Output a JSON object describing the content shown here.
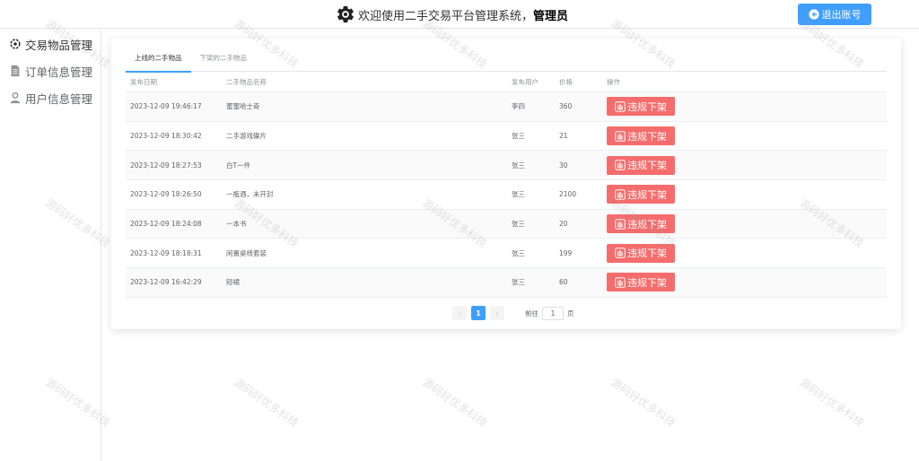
{
  "header": {
    "welcome": "欢迎使用二手交易平台管理系统，",
    "role": "管理员",
    "logout_label": "退出账号"
  },
  "sidebar": {
    "items": [
      {
        "label": "交易物品管理",
        "icon": "goods-gear-icon",
        "active": true
      },
      {
        "label": "订单信息管理",
        "icon": "document-icon",
        "active": false
      },
      {
        "label": "用户信息管理",
        "icon": "user-icon",
        "active": false
      }
    ]
  },
  "tabs": [
    {
      "label": "上线的二手物品",
      "active": true
    },
    {
      "label": "下架的二手物品",
      "active": false
    }
  ],
  "table": {
    "columns": [
      "发布日期",
      "二手物品名称",
      "发布用户",
      "价格",
      "操作"
    ],
    "action_label": "违规下架",
    "rows": [
      {
        "date": "2023-12-09 19:46:17",
        "name": "蜜蜜哈士奇",
        "user": "李四",
        "price": "360"
      },
      {
        "date": "2023-12-09 18:30:42",
        "name": "二手游戏碟片",
        "user": "张三",
        "price": "21"
      },
      {
        "date": "2023-12-09 18:27:53",
        "name": "白T一件",
        "user": "张三",
        "price": "30"
      },
      {
        "date": "2023-12-09 18:26:50",
        "name": "一瓶酒，未开封",
        "user": "张三",
        "price": "2100"
      },
      {
        "date": "2023-12-09 18:24:08",
        "name": "一本书",
        "user": "张三",
        "price": "20"
      },
      {
        "date": "2023-12-09 18:18:31",
        "name": "闲置桌椅套装",
        "user": "张三",
        "price": "199"
      },
      {
        "date": "2023-12-09 16:42:29",
        "name": "短裙",
        "user": "张三",
        "price": "60"
      }
    ]
  },
  "pagination": {
    "current_page": "1",
    "goto_label": "前往",
    "goto_value": "1",
    "page_suffix": "页"
  },
  "watermark": "源码好优多科技",
  "colors": {
    "primary": "#409eff",
    "danger": "#f56c6c"
  }
}
